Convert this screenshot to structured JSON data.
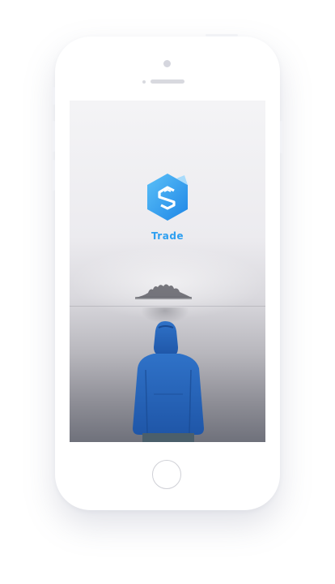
{
  "device": {
    "type": "phone mockup",
    "color": "#ffffff"
  },
  "app": {
    "name": "Trade",
    "logo_icon": "hexagon-s-logo-icon",
    "brand_color": "#2e9ff0"
  },
  "background": {
    "scene": "person-in-blue-jacket-foggy-lake"
  },
  "controls": {
    "home_button_icon": "home-button-circle"
  }
}
